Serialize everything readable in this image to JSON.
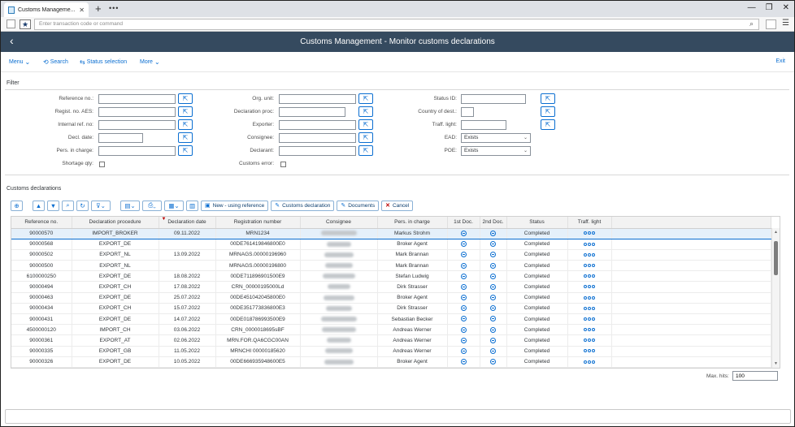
{
  "browser": {
    "tab_title": "Customs Manageme...",
    "new_tab": "+",
    "more_tabs": "•••",
    "window_controls": [
      "—",
      "❐",
      "✕"
    ],
    "command_placeholder": "Enter transaction code or command"
  },
  "shell": {
    "back": "‹",
    "title": "Customs Management - Monitor customs declarations"
  },
  "toolbar": {
    "menu": "Menu",
    "search": "Search",
    "status_selection": "Status selection",
    "more": "More",
    "exit": "Exit"
  },
  "filter": {
    "title": "Filter",
    "col1": [
      {
        "label": "Reference no.:",
        "value": ""
      },
      {
        "label": "Regist. no. AES:",
        "value": ""
      },
      {
        "label": "Internal ref. no:",
        "value": ""
      },
      {
        "label": "Decl. date:",
        "value": ""
      },
      {
        "label": "Pers. in charge:",
        "value": ""
      }
    ],
    "shortage_label": "Shortage qty:",
    "col2": [
      {
        "label": "Org. unit:",
        "value": ""
      },
      {
        "label": "Declaration proc:",
        "value": ""
      },
      {
        "label": "Exporter:",
        "value": ""
      },
      {
        "label": "Consignee:",
        "value": ""
      },
      {
        "label": "Declarant:",
        "value": ""
      }
    ],
    "customs_error_label": "Customs error:",
    "col3": [
      {
        "label": "Status ID:",
        "value": ""
      },
      {
        "label": "Country of dest.:",
        "value": ""
      },
      {
        "label": "Traff. light:",
        "value": ""
      }
    ],
    "ead_label": "EAD:",
    "ead_value": "Exists",
    "poe_label": "POE:",
    "poe_value": "Exists"
  },
  "table": {
    "title": "Customs declarations",
    "buttons": {
      "new_ref": "New - using reference",
      "customs_decl": "Customs declaration",
      "documents": "Documents",
      "cancel": "Cancel"
    },
    "columns": [
      "Reference no.",
      "Declaration procedure",
      "Declaration date",
      "Registration number",
      "Consignee",
      "Pers. in charge",
      "1st Doc.",
      "2nd Doc.",
      "Status",
      "Traff. light"
    ],
    "rows": [
      {
        "ref": "90000570",
        "proc": "IMPORT_BROKER",
        "date": "09.11.2022",
        "reg": "MRN1234",
        "pic": "Markus Strohm",
        "status": "Completed"
      },
      {
        "ref": "90000568",
        "proc": "EXPORT_DE",
        "date": "",
        "reg": "00DE761419846800E0",
        "pic": "Broker Agent",
        "status": "Completed"
      },
      {
        "ref": "90000502",
        "proc": "EXPORT_NL",
        "date": "13.09.2022",
        "reg": "MRNAGS.00000196960",
        "pic": "Mark Brannan",
        "status": "Completed"
      },
      {
        "ref": "90000500",
        "proc": "EXPORT_NL",
        "date": "",
        "reg": "MRNAGS.00000196800",
        "pic": "Mark Brannan",
        "status": "Completed"
      },
      {
        "ref": "6100000250",
        "proc": "EXPORT_DE",
        "date": "18.08.2022",
        "reg": "00DE711896901500E9",
        "pic": "Stefan Ludwig",
        "status": "Completed"
      },
      {
        "ref": "90000494",
        "proc": "EXPORT_CH",
        "date": "17.08.2022",
        "reg": "CRN_00000195000Ld",
        "pic": "Dirk Strasser",
        "status": "Completed"
      },
      {
        "ref": "90000463",
        "proc": "EXPORT_DE",
        "date": "25.07.2022",
        "reg": "00DE451042045800E0",
        "pic": "Broker Agent",
        "status": "Completed"
      },
      {
        "ref": "90000434",
        "proc": "EXPORT_CH",
        "date": "15.07.2022",
        "reg": "00DE351773836800E3",
        "pic": "Dirk Strasser",
        "status": "Completed"
      },
      {
        "ref": "90000431",
        "proc": "EXPORT_DE",
        "date": "14.07.2022",
        "reg": "00DE018786993500E9",
        "pic": "Sebastian Becker",
        "status": "Completed"
      },
      {
        "ref": "4500000120",
        "proc": "IMPORT_CH",
        "date": "03.06.2022",
        "reg": "CRN_0000018695sBF",
        "pic": "Andreas Werner",
        "status": "Completed"
      },
      {
        "ref": "90000361",
        "proc": "EXPORT_AT",
        "date": "02.06.2022",
        "reg": "MRN.FOR.QA6CGC00AN",
        "pic": "Andreas Werner",
        "status": "Completed"
      },
      {
        "ref": "90000335",
        "proc": "EXPORT_GB",
        "date": "11.05.2022",
        "reg": "MRNCHI 00000185620",
        "pic": "Andreas Werner",
        "status": "Completed"
      },
      {
        "ref": "90000326",
        "proc": "EXPORT_DE",
        "date": "10.05.2022",
        "reg": "00DE666935948600E5",
        "pic": "Broker Agent",
        "status": "Completed"
      }
    ],
    "max_hits_label": "Max. hits:",
    "max_hits_value": "100"
  }
}
